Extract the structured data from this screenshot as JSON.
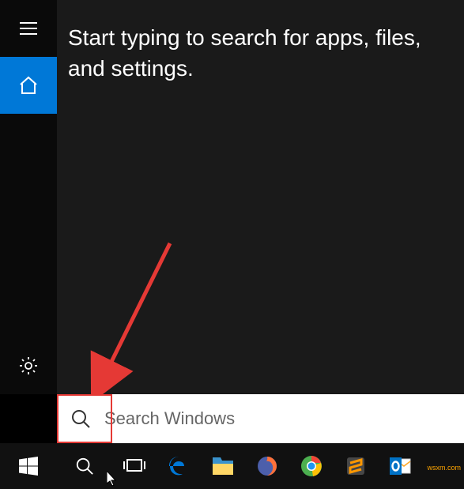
{
  "sidebar": {
    "menu": "menu",
    "home": "home",
    "settings": "settings"
  },
  "main": {
    "prompt": "Start typing to search for apps, files, and settings."
  },
  "search": {
    "placeholder": "Search Windows"
  },
  "taskbar": {
    "start": "Start",
    "search": "Search",
    "taskview": "Task View",
    "apps": [
      {
        "name": "edge",
        "color": "#0078d7"
      },
      {
        "name": "file-explorer",
        "color": "#ffcc00"
      },
      {
        "name": "firefox",
        "color": "#ff7139"
      },
      {
        "name": "chrome",
        "color": "#4caf50"
      },
      {
        "name": "sublime",
        "color": "#ff9800"
      },
      {
        "name": "outlook",
        "color": "#0072c6"
      }
    ]
  },
  "watermark": "wsxm.com"
}
